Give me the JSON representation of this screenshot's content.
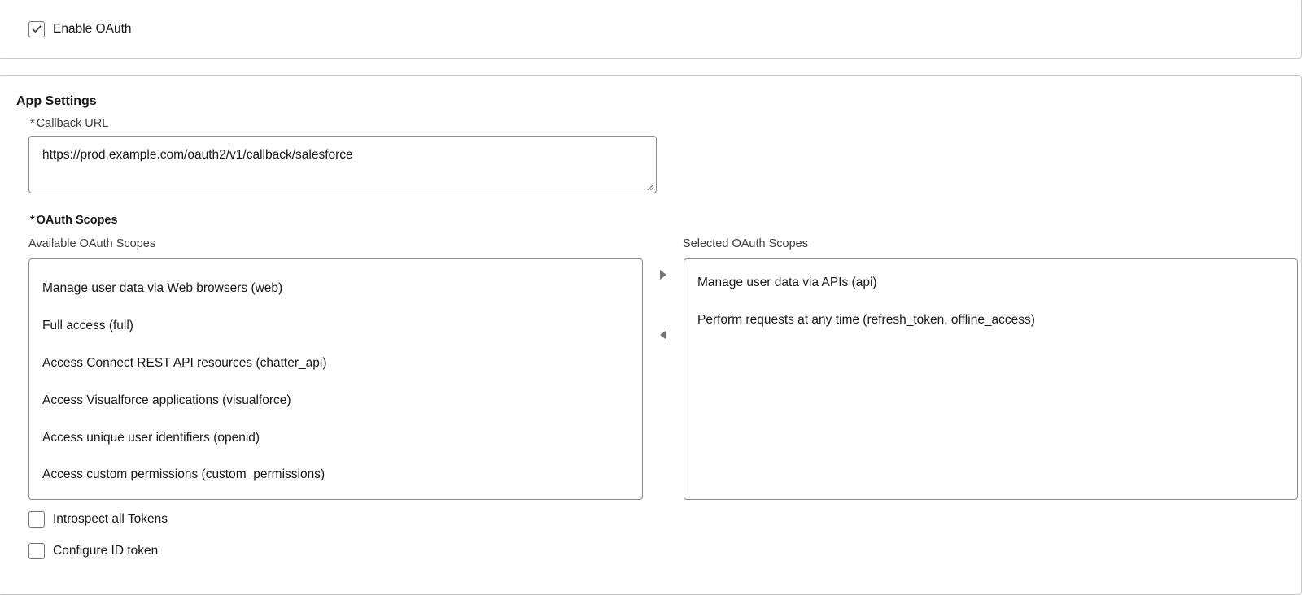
{
  "oauth": {
    "enable_label": "Enable OAuth",
    "enabled": true
  },
  "app_settings": {
    "title": "App Settings",
    "callback_url": {
      "required_marker": "*",
      "label": "Callback URL",
      "value": "https://prod.example.com/oauth2/v1/callback/salesforce"
    },
    "scopes": {
      "required_marker": "*",
      "label": "OAuth Scopes",
      "available_label": "Available OAuth Scopes",
      "selected_label": "Selected OAuth Scopes",
      "available": [
        "Manage user data via Web browsers (web)",
        "Full access (full)",
        "Access Connect REST API resources (chatter_api)",
        "Access Visualforce applications (visualforce)",
        "Access unique user identifiers (openid)",
        "Access custom permissions (custom_permissions)"
      ],
      "selected": [
        "Manage user data via APIs (api)",
        "Perform requests at any time (refresh_token, offline_access)"
      ]
    },
    "introspect_label": "Introspect all Tokens",
    "introspect_checked": false,
    "id_token_label": "Configure ID token",
    "id_token_checked": false
  },
  "icons": {
    "move_right": "triangle-right-icon",
    "move_left": "triangle-left-icon",
    "check": "checkmark-icon"
  },
  "colors": {
    "border": "#8c8c8c",
    "arrow": "#747474",
    "text": "#181818"
  }
}
